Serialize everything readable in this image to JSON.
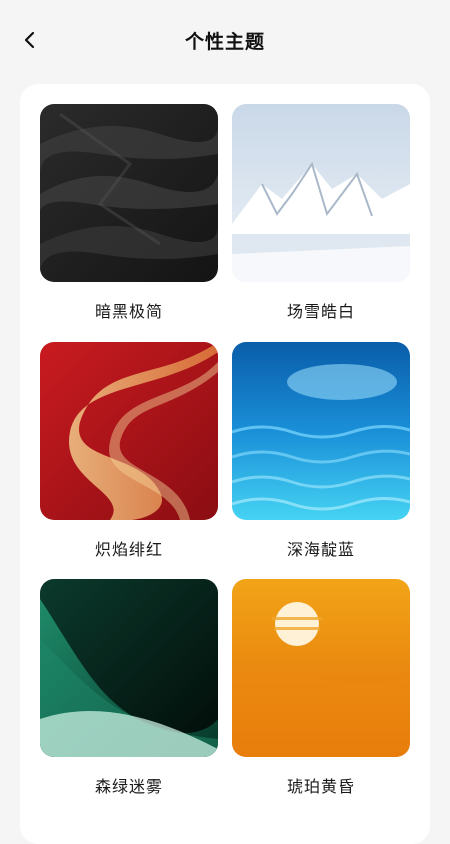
{
  "header": {
    "title": "个性主题",
    "back_icon": "chevron-left-icon"
  },
  "themes": [
    {
      "label": "暗黑极简",
      "colors": [
        "#1b1b1b",
        "#3a3a3a"
      ]
    },
    {
      "label": "场雪皓白",
      "colors": [
        "#dfe8f2",
        "#b7c6d6"
      ]
    },
    {
      "label": "炽焰绯红",
      "colors": [
        "#b8141c",
        "#e7b56c"
      ]
    },
    {
      "label": "深海靛蓝",
      "colors": [
        "#0b6fbe",
        "#3fd0f2"
      ]
    },
    {
      "label": "森绿迷雾",
      "colors": [
        "#05221a",
        "#1fa27f"
      ]
    },
    {
      "label": "琥珀黄昏",
      "colors": [
        "#f3a114",
        "#e26a08"
      ]
    }
  ]
}
